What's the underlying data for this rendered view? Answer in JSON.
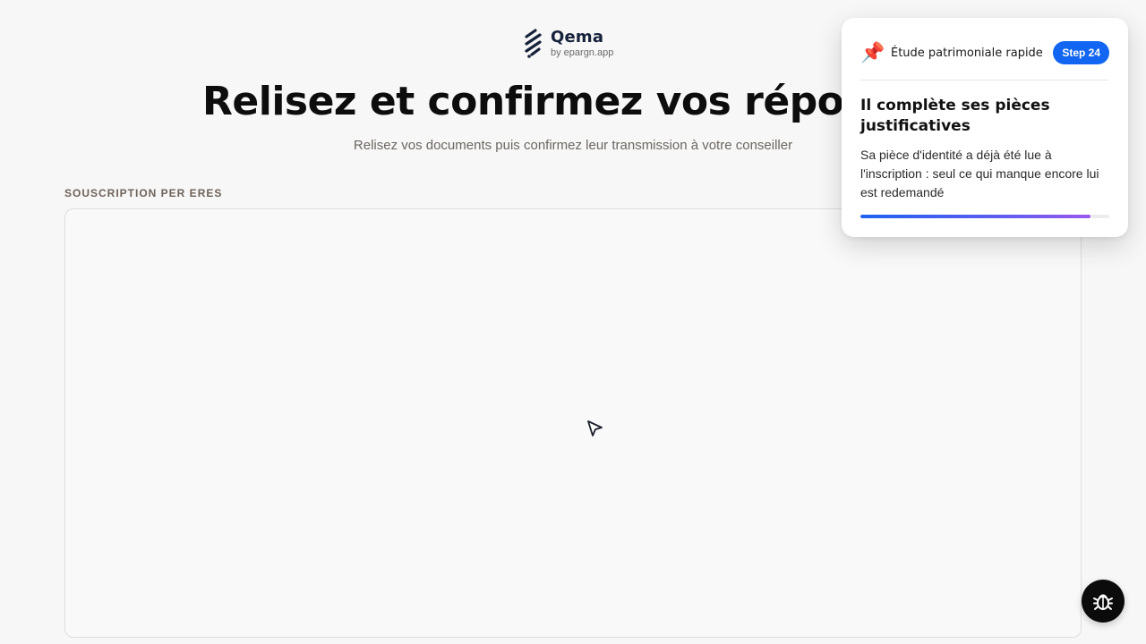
{
  "brand": {
    "name": "Qema",
    "tagline": "by epargn.app"
  },
  "header": {
    "title": "Relisez et confirmez vos réponses",
    "subtitle": "Relisez vos documents puis confirmez leur transmission à votre conseiller"
  },
  "section": {
    "label": "SOUSCRIPTION PER ERES"
  },
  "tour": {
    "icon": "pushpin-icon",
    "name": "Étude patrimoniale rapide",
    "step_label": "Step 24",
    "title": "Il complète ses pièces justificatives",
    "body": "Sa pièce d'identité a déjà été lue à l'inscription : seul ce qui manque encore lui est redemandé",
    "progress": 0.925
  },
  "debug": {
    "icon": "bug-icon"
  },
  "colors": {
    "accent": "#1266f1",
    "progress_end": "#9a59ee",
    "brand_dark": "#16213a"
  }
}
